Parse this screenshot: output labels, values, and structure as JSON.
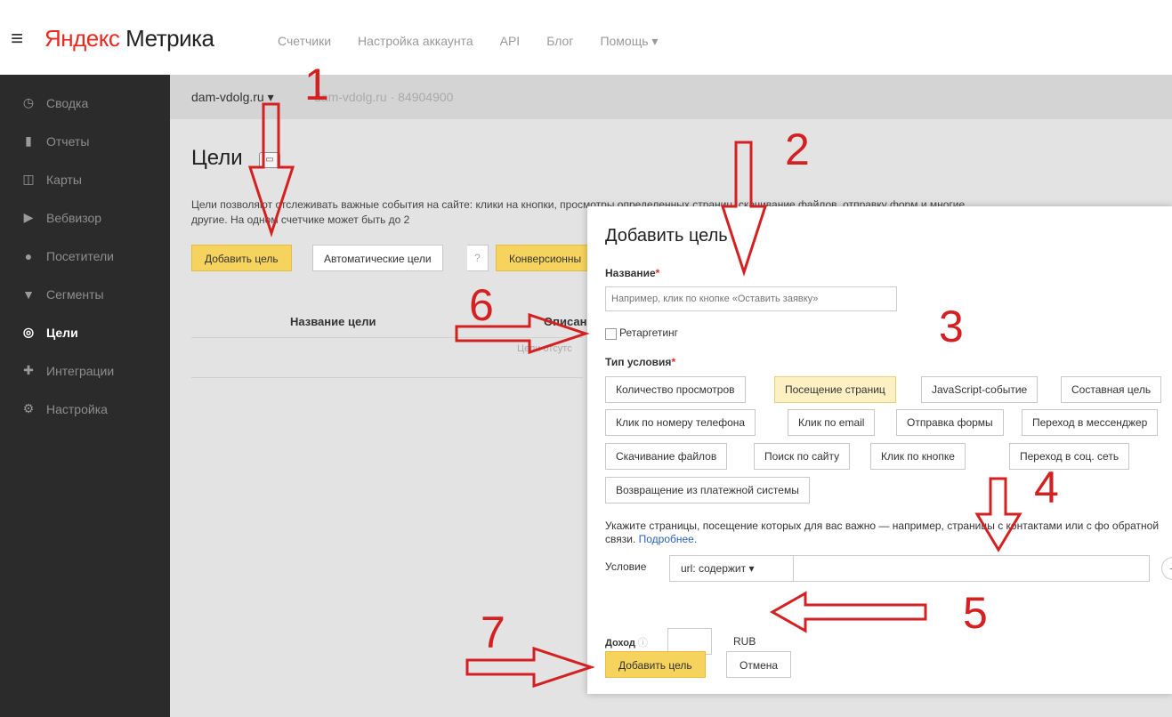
{
  "header": {
    "logo_prefix": "Яндекс",
    "logo_suffix": " Метрика",
    "nav": [
      "Счетчики",
      "Настройка аккаунта",
      "API",
      "Блог",
      "Помощь ▾"
    ]
  },
  "sidebar": {
    "items": [
      {
        "label": "Сводка",
        "icon": "dashboard-icon"
      },
      {
        "label": "Отчеты",
        "icon": "reports-icon"
      },
      {
        "label": "Карты",
        "icon": "maps-icon"
      },
      {
        "label": "Вебвизор",
        "icon": "play-icon"
      },
      {
        "label": "Посетители",
        "icon": "user-icon"
      },
      {
        "label": "Сегменты",
        "icon": "filter-icon"
      },
      {
        "label": "Цели",
        "icon": "target-icon",
        "active": true
      },
      {
        "label": "Интеграции",
        "icon": "integrations-icon"
      },
      {
        "label": "Настройка",
        "icon": "gear-icon"
      }
    ]
  },
  "counter": {
    "name": "dam-vdolg.ru ▾",
    "id": "dam-vdolg.ru · 84904900"
  },
  "page": {
    "title": "Цели",
    "description": "Цели позволяют отслеживать важные события на сайте: клики на кнопки, просмотры определенных страниц, скачивание файлов, отправку форм и многие другие. На одном счетчике может быть до 2",
    "add_goal": "Добавить цель",
    "auto_goals": "Автоматические цели",
    "help": "?",
    "conversion": "Конверсионны",
    "col_name": "Название цели",
    "col_desc": "Описан",
    "empty": "Цели отсутс"
  },
  "dialog": {
    "title": "Добавить цель",
    "name_label": "Название",
    "name_placeholder": "Например, клик по кнопке «Оставить заявку»",
    "retargeting": "Ретаргетинг",
    "type_label": "Тип условия",
    "types": [
      "Количество просмотров",
      "Посещение страниц",
      "JavaScript-событие",
      "Составная цель",
      "Клик по номеру телефона",
      "Клик по email",
      "Отправка формы",
      "Переход в мессенджер",
      "Скачивание файлов",
      "Поиск по сайту",
      "Клик по кнопке",
      "Переход в соц. сеть",
      "Возвращение из платежной системы"
    ],
    "active_type": "Посещение страниц",
    "hint": "Укажите страницы, посещение которых для вас важно — например, страницы с контактами или с фо обратной связи. ",
    "hint_link": "Подробнее.",
    "condition_label": "Условие",
    "condition_value": "url: содержит ▾",
    "plus": "+",
    "income_label": "Доход",
    "currency": "RUB",
    "submit": "Добавить цель",
    "cancel": "Отмена"
  },
  "annotations": [
    "1",
    "2",
    "3",
    "4",
    "5",
    "6",
    "7"
  ],
  "colors": {
    "accent_yellow": "#f6d35c",
    "annotation_red": "#d42020",
    "sidebar_bg": "#2b2b2b",
    "logo_red": "#e62b20"
  }
}
